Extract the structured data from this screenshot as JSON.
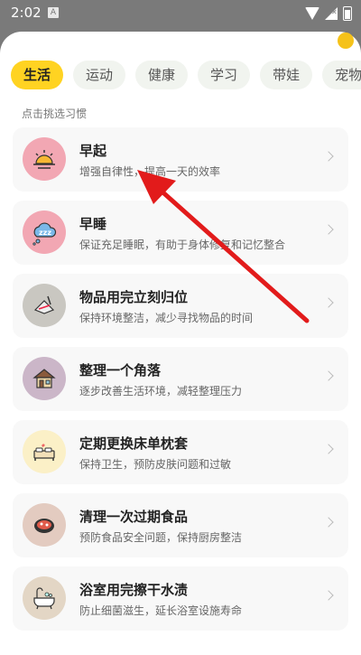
{
  "status": {
    "time": "2:02",
    "notif_glyph": "A"
  },
  "tabs": [
    {
      "label": "生活",
      "active": true
    },
    {
      "label": "运动",
      "active": false
    },
    {
      "label": "健康",
      "active": false
    },
    {
      "label": "学习",
      "active": false
    },
    {
      "label": "带娃",
      "active": false
    },
    {
      "label": "宠物",
      "active": false
    }
  ],
  "hint": "点击挑选习惯",
  "habits": [
    {
      "title": "早起",
      "desc": "增强自律性，提高一天的效率",
      "icon": "sunrise-icon",
      "bg": "#f2a7b3"
    },
    {
      "title": "早睡",
      "desc": "保证充足睡眠，有助于身体修复和记忆整合",
      "icon": "sleep-cloud-icon",
      "bg": "#f2a7b3"
    },
    {
      "title": "物品用完立刻归位",
      "desc": "保持环境整洁，减少寻找物品的时间",
      "icon": "stationery-icon",
      "bg": "#c9c7c1"
    },
    {
      "title": "整理一个角落",
      "desc": "逐步改善生活环境，减轻整理压力",
      "icon": "house-icon",
      "bg": "#cbb6c8"
    },
    {
      "title": "定期更换床单枕套",
      "desc": "保持卫生，预防皮肤问题和过敏",
      "icon": "bed-icon",
      "bg": "#fbf0c7"
    },
    {
      "title": "清理一次过期食品",
      "desc": "预防食品安全问题，保持厨房整洁",
      "icon": "food-box-icon",
      "bg": "#e3cbc0"
    },
    {
      "title": "浴室用完擦干水渍",
      "desc": "防止细菌滋生，延长浴室设施寿命",
      "icon": "bathtub-icon",
      "bg": "#e3d6c5"
    }
  ]
}
